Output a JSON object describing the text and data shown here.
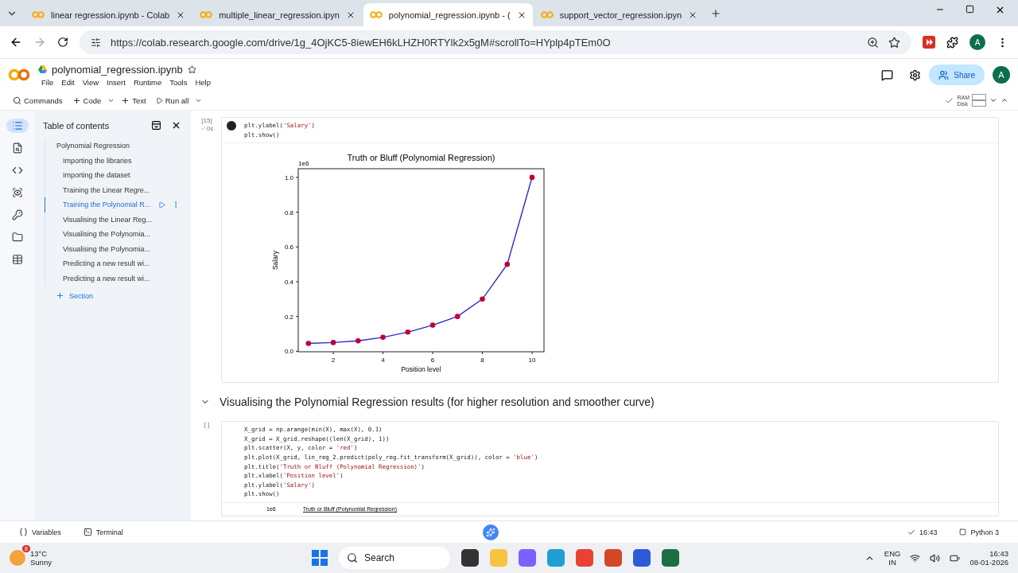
{
  "browser_tabs": [
    {
      "title": "linear regression.ipynb - Colab",
      "selected": false
    },
    {
      "title": "multiple_linear_regression.ipyn",
      "selected": false
    },
    {
      "title": "polynomial_regression.ipynb - (",
      "selected": true
    },
    {
      "title": "support_vector_regression.ipyn",
      "selected": false
    }
  ],
  "address_bar": {
    "url": "https://colab.research.google.com/drive/1g_4OjKC5-8iewEH6kLHZH0RTYlk2x5gM#scrollTo=HYplp4pTEm0O"
  },
  "profile_initial": "A",
  "notebook": {
    "title": "polynomial_regression.ipynb",
    "menu": [
      "File",
      "Edit",
      "View",
      "Insert",
      "Runtime",
      "Tools",
      "Help"
    ],
    "share": "Share",
    "avatar": "A"
  },
  "toolbar": {
    "commands": "Commands",
    "add_code": "Code",
    "add_text": "Text",
    "run_all": "Run all",
    "ram": "RAM",
    "disk": "Disk"
  },
  "toc": {
    "title": "Table of contents",
    "items": [
      {
        "label": "Polynomial Regression",
        "selected": false,
        "children": [
          {
            "label": "Importing the libraries",
            "selected": false
          },
          {
            "label": "Importing the dataset",
            "selected": false
          },
          {
            "label": "Training the Linear Regre...",
            "selected": false
          },
          {
            "label": "Training the Polynomial R...",
            "selected": true
          },
          {
            "label": "Visualising the Linear Reg...",
            "selected": false
          },
          {
            "label": "Visualising the Polynomia...",
            "selected": false
          },
          {
            "label": "Visualising the Polynomia...",
            "selected": false
          },
          {
            "label": "Predicting a new result wi...",
            "selected": false
          },
          {
            "label": "Predicting a new result wi...",
            "selected": false
          }
        ]
      }
    ],
    "add_section": "Section"
  },
  "cells": [
    {
      "kind": "code",
      "exec_count": "[15]",
      "exec_time": "0s",
      "lines": [
        "plt.ylabel('Salary')",
        "plt.show()"
      ],
      "output": {
        "kind": "chart",
        "chart_data": {
          "type": "line",
          "title": "Truth or Bluff (Polynomial Regression)",
          "xlabel": "Position level",
          "ylabel": "Salary",
          "x": [
            1,
            2,
            3,
            4,
            5,
            6,
            7,
            8,
            9,
            10
          ],
          "series": [
            {
              "color": "#2a2ac8",
              "marker": "o",
              "values": [
                0.045,
                0.05,
                0.06,
                0.08,
                0.11,
                0.15,
                0.2,
                0.3,
                0.5,
                1.0
              ]
            }
          ],
          "xlim": [
            0.59,
            10.48
          ],
          "ylim": [
            -0.003,
            1.05
          ],
          "xticks": [
            2,
            4,
            6,
            8,
            10
          ],
          "yticks": [
            {
              "value": 0,
              "label": "0.0"
            },
            {
              "value": 0.2,
              "label": "0.2"
            },
            {
              "value": 0.4,
              "label": "0.4"
            },
            {
              "value": 0.6,
              "label": "0.6"
            },
            {
              "value": 0.8,
              "label": "0.8"
            },
            {
              "value": 1,
              "label": "1.0"
            }
          ],
          "annotations": [
            "1e6"
          ]
        }
      }
    },
    {
      "kind": "heading",
      "text": "Visualising the Polynomial Regression results (for higher resolution and smoother curve)"
    },
    {
      "kind": "code",
      "exec_count": "[ ]",
      "lines": [
        "X_grid = np.arange(min(X), max(X), 0.1)",
        "X_grid = X_grid.reshape((len(X_grid), 1))",
        "plt.scatter(X, y, color = 'red')",
        "plt.plot(X_grid, lin_reg_2.predict(poly_reg.fit_transform(X_grid)), color = 'blue')",
        "plt.title('Truth or Bluff (Polynomial Regression)')",
        "plt.xlabel('Position level')",
        "plt.ylabel('Salary')",
        "plt.show()"
      ],
      "output": {
        "kind": "partial",
        "offset": "1e6",
        "title": "Truth or Bluff (Polynomial Regression)"
      }
    }
  ],
  "status_bar": {
    "variables": "Variables",
    "terminal": "Terminal",
    "time": "16:43",
    "runtime": "Python 3"
  },
  "taskbar": {
    "weather_badge": "8",
    "temperature": "13°C",
    "weather": "Sunny",
    "search": "Search",
    "lang": "ENG",
    "region": "IN",
    "time": "16:43",
    "date": "08-01-2026"
  }
}
